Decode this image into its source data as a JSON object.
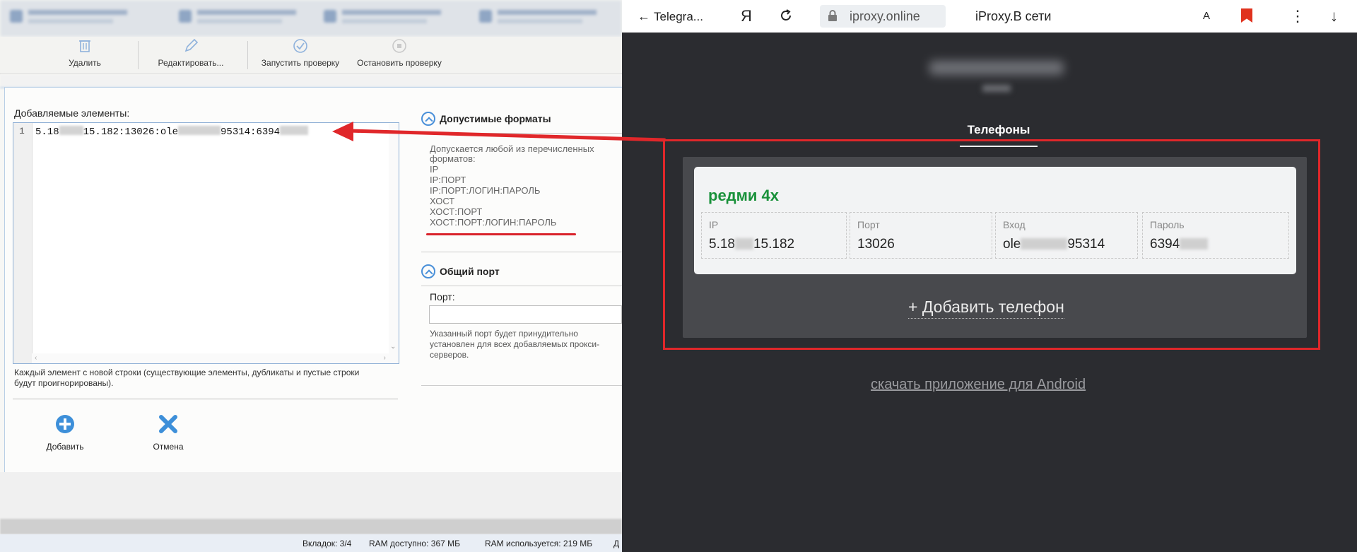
{
  "app": {
    "toolbar": {
      "delete_label": "Удалить",
      "edit_label": "Редактировать...",
      "start_check_label": "Запустить проверку",
      "stop_check_label": "Остановить проверку"
    },
    "dialog": {
      "added_items_label": "Добавляемые элементы:",
      "editor": {
        "line_number": "1",
        "line_start": "5.18",
        "line_mid": "15.182:13026:ole",
        "line_mid2": "95314:6394"
      },
      "editor_hint": "Каждый элемент с новой строки (существующие элементы, дубликаты и пустые строки будут проигнорированы).",
      "add_button_label": "Добавить",
      "cancel_button_label": "Отмена",
      "formats_section": {
        "title": "Допустимые форматы",
        "description": "Допускается любой из перечисленных форматов:",
        "formats": [
          "IP",
          "IP:ПОРТ",
          "IP:ПОРТ:ЛОГИН:ПАРОЛЬ",
          "ХОСТ",
          "ХОСТ:ПОРТ",
          "ХОСТ:ПОРТ:ЛОГИН:ПАРОЛЬ"
        ]
      },
      "common_port_section": {
        "title": "Общий порт",
        "port_label": "Порт:",
        "port_value": "",
        "hint": "Указанный порт будет принудительно установлен для всех добавляемых прокси-серверов."
      }
    },
    "statusbar": {
      "tabs": "Вкладок: 3/4",
      "ram_available": "RAM доступно: 367 МБ",
      "ram_used": "RAM используется: 219 МБ",
      "extra": "Д"
    }
  },
  "browser": {
    "back_label": "Telegra...",
    "yandex_logo": "Я",
    "domain": "iproxy.online",
    "page_title": "iProxy.В сети",
    "translate_glyph": "A",
    "more_glyph": "⋮",
    "download_glyph": "↓",
    "phones_tab": "Телефоны",
    "phone": {
      "name": "редми 4х",
      "ip_label": "IP",
      "ip_start": "5.18",
      "ip_end": "15.182",
      "port_label": "Порт",
      "port_value": "13026",
      "login_label": "Вход",
      "login_start": "ole",
      "login_end": "95314",
      "password_label": "Пароль",
      "password_start": "6394"
    },
    "add_phone_label": "+ Добавить телефон",
    "android_link": "скачать приложение для Android"
  },
  "colors": {
    "accent_blue": "#4a90d9",
    "annotation_red": "#e0272a",
    "phone_name_green": "#19913a",
    "browser_bg": "#2b2c30"
  }
}
